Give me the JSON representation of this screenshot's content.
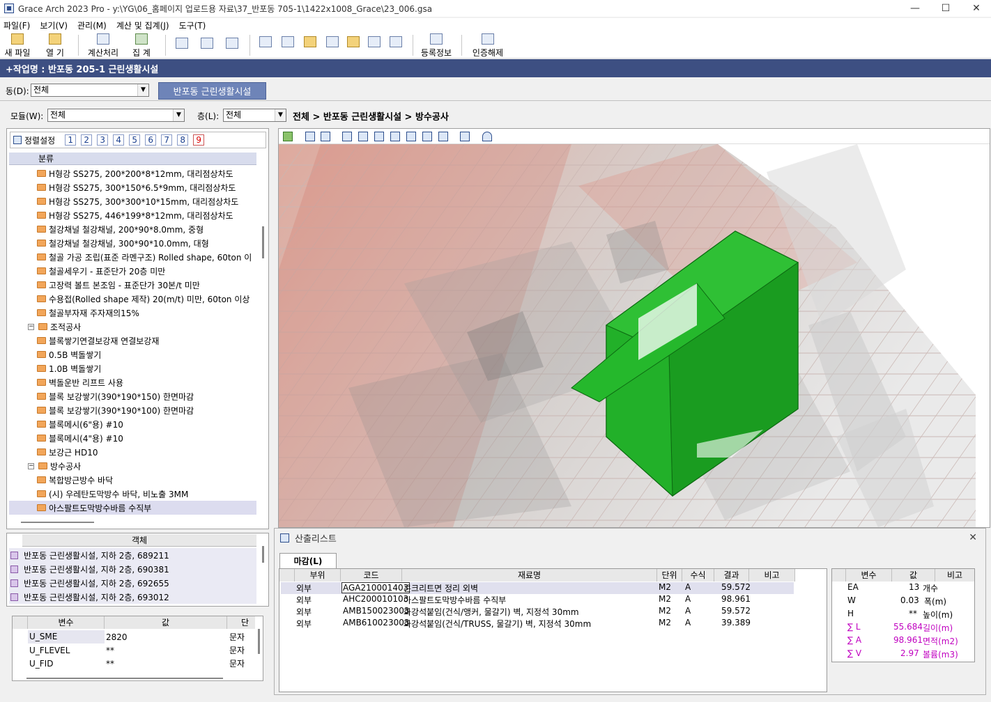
{
  "window": {
    "title": "Grace Arch 2023 Pro - y:\\YG\\06_홈페이지 업로드용 자료\\37_반포동 705-1\\1422x1008_Grace\\23_006.gsa",
    "minimize": "—",
    "maximize": "☐",
    "close": "✕"
  },
  "menu": [
    "파일(F)",
    "보기(V)",
    "관리(M)",
    "계산 및 집계(J)",
    "도구(T)"
  ],
  "toolbar": {
    "new": "새 파일",
    "open": "열 기",
    "calc": "계산처리",
    "sum": "집 계",
    "reg": "등록정보",
    "auth": "인증해제"
  },
  "project": {
    "label": "+작업명 : 반포동 205-1 근린생활시설"
  },
  "filters": {
    "dong_label": "동(D):",
    "dong_value": "전체",
    "building_tab": "반포동 근린생활시설",
    "model_label": "모듈(W):",
    "model_value": "전체",
    "floor_label": "층(L):",
    "floor_value": "전체",
    "breadcrumb": "전체 > 반포동 근린생활시설 > 방수공사"
  },
  "sort": {
    "label": "정렬설정",
    "buttons": [
      "1",
      "2",
      "3",
      "4",
      "5",
      "6",
      "7",
      "8",
      "9"
    ]
  },
  "tree": {
    "header": "분류",
    "items": [
      {
        "text": "H형강   SS275, 200*200*8*12mm, 대리점상차도"
      },
      {
        "text": "H형강   SS275, 300*150*6.5*9mm, 대리점상차도"
      },
      {
        "text": "H형강   SS275, 300*300*10*15mm, 대리점상차도"
      },
      {
        "text": "H형강   SS275, 446*199*8*12mm, 대리점상차도"
      },
      {
        "text": "철강채널  철강채널, 200*90*8.0mm, 중형"
      },
      {
        "text": "철강채널  철강채널, 300*90*10.0mm, 대형"
      },
      {
        "text": "철골 가공 조립(표준 라멘구조)  Rolled shape, 60ton 이"
      },
      {
        "text": "철골세우기 - 표준단가  20층 미만"
      },
      {
        "text": "고장력 볼트 본조임 - 표준단가  30본/t 미만"
      },
      {
        "text": "수용접(Rolled shape 제작)  20(m/t) 미만, 60ton 이상"
      },
      {
        "text": "철골부자재  주자재의15%"
      },
      {
        "text": "조적공사"
      },
      {
        "text": "블록쌓기연결보강재  연결보강재"
      },
      {
        "text": "0.5B 벽돌쌓기"
      },
      {
        "text": "1.0B 벽돌쌓기"
      },
      {
        "text": "벽돌운반  리프트 사용"
      },
      {
        "text": "블록 보강쌓기(390*190*150)  한면마감"
      },
      {
        "text": "블록 보강쌓기(390*190*100)  한면마감"
      },
      {
        "text": "블록메시(6\"용)  #10"
      },
      {
        "text": "블록메시(4\"용)  #10"
      },
      {
        "text": "보강근  HD10"
      },
      {
        "text": "방수공사"
      },
      {
        "text": "복합방근방수  바닥"
      },
      {
        "text": "(시) 우레탄도막방수  바닥, 비노출 3MM"
      },
      {
        "text": "아스팔트도막방수바름  수직부"
      }
    ]
  },
  "objects": {
    "header": "객체",
    "items": [
      "반포동 근린생활시설, 지하 2층, 689211",
      "반포동 근린생활시설, 지하 2층, 690381",
      "반포동 근린생활시설, 지하 2층, 692655",
      "반포동 근린생활시설, 지하 2층, 693012"
    ]
  },
  "vars": {
    "headers": [
      "변수",
      "값",
      "단위"
    ],
    "rows": [
      {
        "name": "U_SME",
        "value": "2820",
        "unit": "문자"
      },
      {
        "name": "U_FLEVEL",
        "value": "**",
        "unit": "문자"
      },
      {
        "name": "U_FID",
        "value": "**",
        "unit": "문자"
      }
    ]
  },
  "calc": {
    "title": "산출리스트",
    "tab": "마감(L)",
    "headers": [
      "부위",
      "코드",
      "재료명",
      "단위",
      "수식",
      "결과",
      "비고"
    ],
    "rows": [
      {
        "part": "외부",
        "code": "AGA210001403",
        "name": "콘크리트면 정리  외벽",
        "unit": "M2",
        "formula": "A",
        "result": "59.572"
      },
      {
        "part": "외부",
        "code": "AHC200010103",
        "name": "아스팔트도막방수바름  수직부",
        "unit": "M2",
        "formula": "A",
        "result": "98.961"
      },
      {
        "part": "외부",
        "code": "AMB150023003",
        "name": "화강석붙임(건식/앵커, 물갈기)  벽, 지정석 30mm",
        "unit": "M2",
        "formula": "A",
        "result": "59.572"
      },
      {
        "part": "외부",
        "code": "AMB610023003",
        "name": "화강석붙임(건식/TRUSS, 물갈기)  벽, 지정석 30mm",
        "unit": "M2",
        "formula": "A",
        "result": "39.389"
      }
    ],
    "summary_headers": [
      "변수",
      "값",
      "비고"
    ],
    "summary": [
      {
        "var": "EA",
        "value": "13",
        "note": "개수"
      },
      {
        "var": "W",
        "value": "0.03",
        "note": "폭(m)"
      },
      {
        "var": "H",
        "value": "**",
        "note": "높이(m)"
      },
      {
        "var": "∑ L",
        "value": "55.684",
        "note": "길이(m)"
      },
      {
        "var": "∑ A",
        "value": "98.961",
        "note": "면적(m2)"
      },
      {
        "var": "∑ V",
        "value": "2.97",
        "note": "볼륨(m3)"
      }
    ]
  },
  "colors": {
    "accent": "#3d4f82",
    "highlight_green": "#1fa82a",
    "magenta": "#c000c0"
  }
}
